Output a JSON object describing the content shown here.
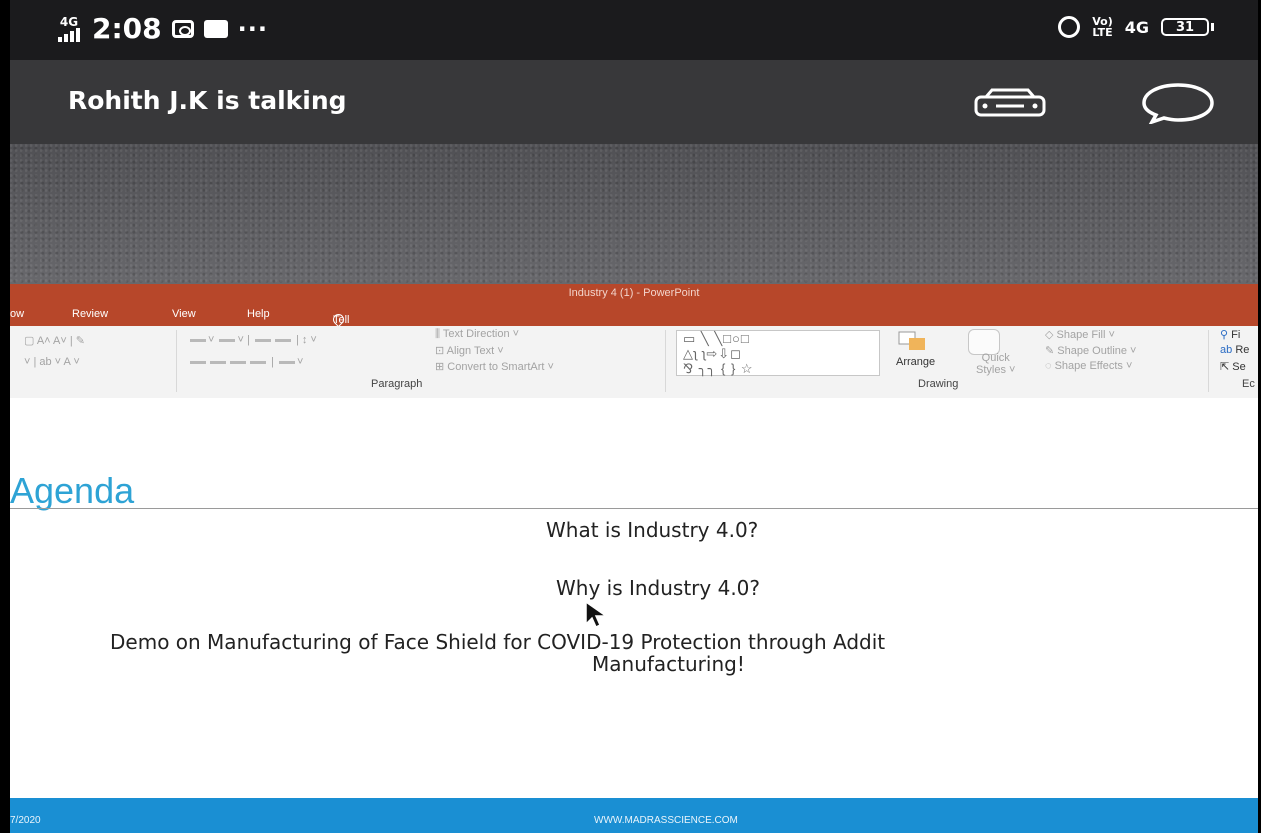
{
  "status_bar": {
    "network": "4G",
    "time": "2:08",
    "more": "···",
    "volte": [
      "Vo)",
      "LTE"
    ],
    "network_right": "4G",
    "battery": "31"
  },
  "call": {
    "title": "Rohith J.K is talking"
  },
  "powerpoint": {
    "window_title": "Industry 4 (1)  -  PowerPoint",
    "tabs": [
      "ow",
      "Review",
      "View",
      "Help"
    ],
    "tell_me": "Tell me what you want to do",
    "ribbon": {
      "text_direction": "Text Direction",
      "align_text": "Align Text",
      "convert_smartart": "Convert to SmartArt",
      "paragraph_group": "Paragraph",
      "arrange": "Arrange",
      "quick_styles": [
        "Quick",
        "Styles"
      ],
      "shape_fill": "Shape Fill",
      "shape_outline": "Shape Outline",
      "shape_effects": "Shape Effects",
      "drawing_group": "Drawing",
      "find_partial": "Fi",
      "replace_partial": "Re",
      "select_partial": "Se",
      "editing_partial": "Ec"
    }
  },
  "slide": {
    "heading": "Agenda",
    "bullets": [
      "What is  Industry 4.0?",
      "Why is Industry 4.0?",
      "Demo on Manufacturing of Face Shield for COVID-19 Protection through Addit",
      "Manufacturing!"
    ],
    "footer_date": "7/2020",
    "footer_site": "WWW.MADRASSCIENCE.COM"
  },
  "colors": {
    "ppt_accent": "#b7472a",
    "heading_blue": "#2ea3d5",
    "footer_blue": "#1a8fd3"
  }
}
